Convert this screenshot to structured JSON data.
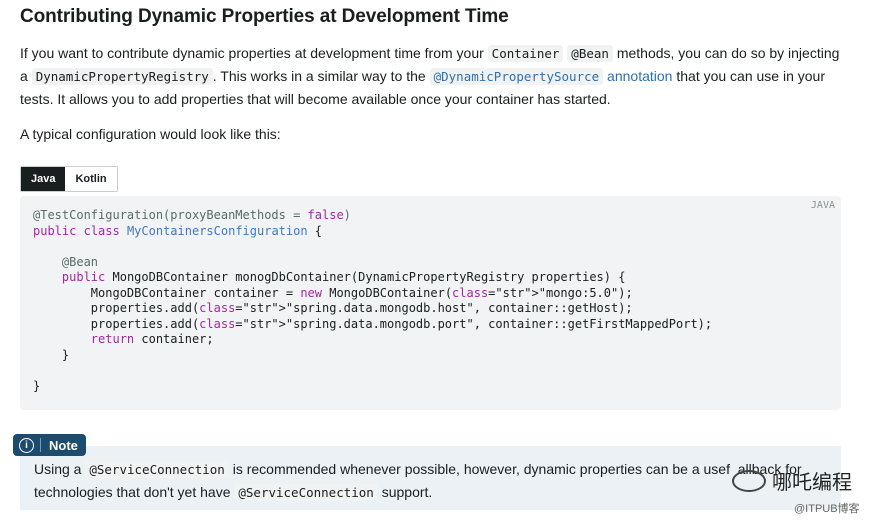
{
  "heading": "Contributing Dynamic Properties at Development Time",
  "intro": {
    "p1a": "If you want to contribute dynamic properties at development time from your ",
    "code_container": "Container",
    "p1b": " ",
    "code_bean": "@Bean",
    "p1c": " methods, you can do so by injecting a ",
    "code_registry": "DynamicPropertyRegistry",
    "p1d": ". This works in a similar way to the ",
    "link_code": "@DynamicPropertySource",
    "link_text": " annotation",
    "p1e": " that you can use in your tests. It allows you to add properties that will become available once your container has started."
  },
  "typical": "A typical configuration would look like this:",
  "tabs": [
    {
      "label": "Java",
      "active": true
    },
    {
      "label": "Kotlin",
      "active": false
    }
  ],
  "code": {
    "language": "JAVA",
    "lines": [
      "@TestConfiguration(proxyBeanMethods = false)",
      "public class MyContainersConfiguration {",
      "",
      "    @Bean",
      "    public MongoDBContainer monogDbContainer(DynamicPropertyRegistry properties) {",
      "        MongoDBContainer container = new MongoDBContainer(\"mongo:5.0\");",
      "        properties.add(\"spring.data.mongodb.host\", container::getHost);",
      "        properties.add(\"spring.data.mongodb.port\", container::getFirstMappedPort);",
      "        return container;",
      "    }",
      "",
      "}"
    ]
  },
  "note": {
    "badge": "Note",
    "icon": "info-icon",
    "t1": "Using a ",
    "code1": "@ServiceConnection",
    "t2": " is recommended whenever possible, however, dynamic properties can be a usef",
    "t3": "allback for",
    "t4": "technologies that don't yet have ",
    "code2": "@ServiceConnection",
    "t5": " support."
  },
  "watermark": {
    "main": "哪吒编程",
    "sub": "@ITPUB博客"
  }
}
